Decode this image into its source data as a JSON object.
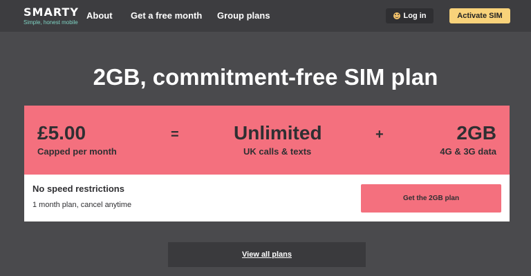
{
  "header": {
    "logo_name": "SMARTY",
    "logo_tagline": "Simple, honest mobile",
    "nav": [
      "About",
      "Get a free month",
      "Group plans"
    ],
    "login_label": "Log in",
    "activate_label": "Activate SIM"
  },
  "hero": {
    "title": "2GB, commitment-free SIM plan"
  },
  "plan": {
    "price": "£5.00",
    "price_sub": "Capped per month",
    "equals": "=",
    "calls": "Unlimited",
    "calls_sub": "UK calls & texts",
    "plus": "+",
    "data": "2GB",
    "data_sub": "4G & 3G data",
    "feature_title": "No speed restrictions",
    "feature_sub": "1 month plan, cancel anytime",
    "cta_label": "Get the 2GB plan"
  },
  "footer": {
    "view_all_label": "View all plans"
  },
  "colors": {
    "background": "#4a4a4d",
    "header": "#3d3d40",
    "accent_pink": "#f4707e",
    "accent_yellow": "#f8d27a"
  }
}
